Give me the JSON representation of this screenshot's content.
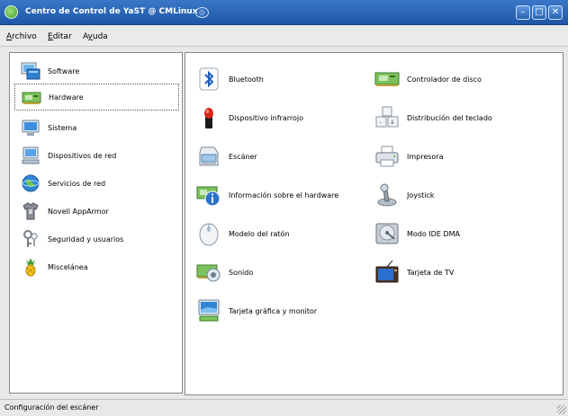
{
  "window": {
    "title": "Centro de Control de YaST @ CMLinux",
    "buttons": {
      "minimize": "–",
      "maximize": "□",
      "close": "✕"
    }
  },
  "menubar": {
    "items": [
      {
        "accel": "A",
        "rest": "rchivo"
      },
      {
        "accel": "E",
        "rest": "ditar"
      },
      {
        "pre": "A",
        "accel": "y",
        "rest": "uda"
      }
    ]
  },
  "sidebar": {
    "items": [
      {
        "label": "Software",
        "icon": "software-icon"
      },
      {
        "label": "Hardware",
        "icon": "hardware-icon",
        "selected": true
      },
      {
        "label": "Sistema",
        "icon": "system-monitor-icon"
      },
      {
        "label": "Dispositivos de red",
        "icon": "network-devices-icon"
      },
      {
        "label": "Servicios de red",
        "icon": "network-services-globe-icon"
      },
      {
        "label": "Novell AppArmor",
        "icon": "apparmor-shirt-icon"
      },
      {
        "label": "Seguridad y usuarios",
        "icon": "security-keys-icon"
      },
      {
        "label": "Miscelánea",
        "icon": "misc-pineapple-icon"
      }
    ]
  },
  "modules": {
    "left": [
      {
        "label": "Bluetooth",
        "icon": "bluetooth-icon"
      },
      {
        "label": "Dispositivo infrarrojo",
        "icon": "infrared-icon"
      },
      {
        "label": "Escáner",
        "icon": "scanner-icon"
      },
      {
        "label": "Información sobre el hardware",
        "icon": "hardware-info-icon"
      },
      {
        "label": "Modelo del ratón",
        "icon": "mouse-icon"
      },
      {
        "label": "Sonido",
        "icon": "sound-icon"
      },
      {
        "label": "Tarjeta gráfica y monitor",
        "icon": "graphics-card-monitor-icon"
      }
    ],
    "right": [
      {
        "label": "Controlador de disco",
        "icon": "disk-controller-icon"
      },
      {
        "label": "Distribución del teclado",
        "icon": "keyboard-layout-icon"
      },
      {
        "label": "Impresora",
        "icon": "printer-icon"
      },
      {
        "label": "Joystick",
        "icon": "joystick-icon"
      },
      {
        "label": "Modo IDE DMA",
        "icon": "ide-dma-icon"
      },
      {
        "label": "Tarjeta de TV",
        "icon": "tv-card-icon"
      }
    ]
  },
  "statusbar": {
    "text": "Configuración del escáner"
  },
  "colors": {
    "titlebar": "#2d66b8",
    "selection_border": "#555555",
    "background": "#e8e8e8"
  }
}
